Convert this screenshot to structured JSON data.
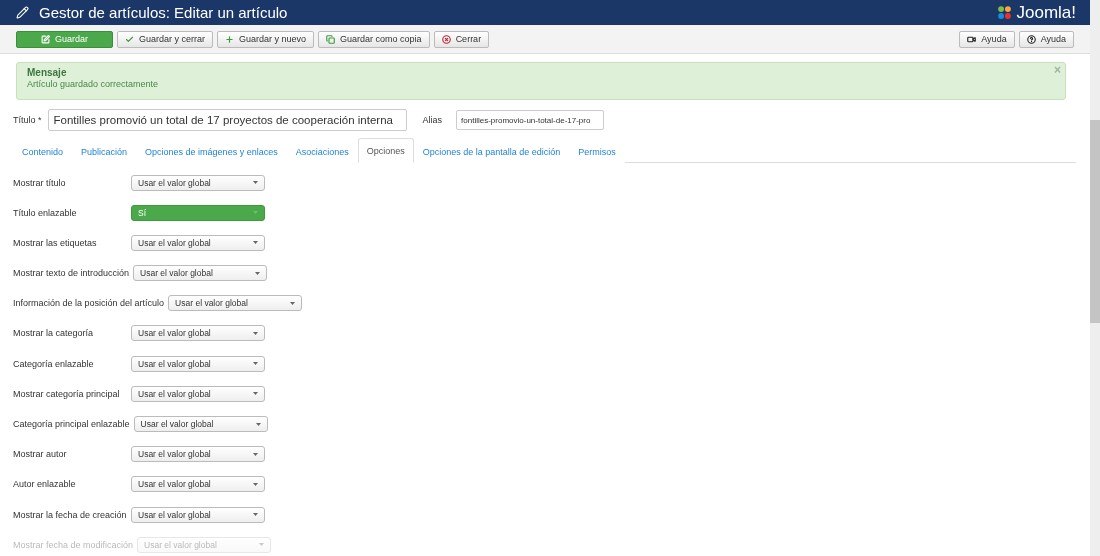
{
  "header": {
    "title": "Gestor de artículos: Editar un artículo",
    "logo": "Joomla!"
  },
  "toolbar": {
    "left": [
      {
        "label": "Guardar",
        "kind": "primary"
      },
      {
        "label": "Guardar y cerrar",
        "kind": "default"
      },
      {
        "label": "Guardar y nuevo",
        "kind": "default"
      },
      {
        "label": "Guardar como copia",
        "kind": "default"
      },
      {
        "label": "Cerrar",
        "kind": "default"
      }
    ],
    "right": [
      {
        "label": "Ayuda"
      },
      {
        "label": "Ayuda"
      }
    ]
  },
  "message": {
    "heading": "Mensaje",
    "text": "Artículo guardado correctamente",
    "close": "×"
  },
  "title_field": {
    "label": "Título *",
    "value": "Fontilles promovió un total de 17 proyectos de cooperación interna"
  },
  "alias_field": {
    "label": "Alias",
    "value": "fontilles-promovio-un-total-de-17-pro"
  },
  "tabs": [
    {
      "label": "Contenido",
      "selected": false
    },
    {
      "label": "Publicación",
      "selected": false
    },
    {
      "label": "Opciones de imágenes y enlaces",
      "selected": false
    },
    {
      "label": "Asociaciones",
      "selected": false
    },
    {
      "label": "Opciones",
      "selected": true
    },
    {
      "label": "Opciones de la pantalla de edición",
      "selected": false
    },
    {
      "label": "Permisos",
      "selected": false
    }
  ],
  "options": [
    {
      "label": "Mostrar título",
      "value": "Usar el valor global",
      "kind": "plain"
    },
    {
      "label": "Título enlazable",
      "value": "Sí",
      "kind": "yes"
    },
    {
      "label": "Mostrar las etiquetas",
      "value": "Usar el valor global",
      "kind": "plain"
    },
    {
      "label": "Mostrar texto de introducción",
      "value": "Usar el valor global",
      "kind": "plain"
    },
    {
      "label": "Información de la posición del artículo",
      "value": "Usar el valor global",
      "kind": "plain"
    },
    {
      "label": "Mostrar la categoría",
      "value": "Usar el valor global",
      "kind": "plain"
    },
    {
      "label": "Categoría enlazable",
      "value": "Usar el valor global",
      "kind": "plain"
    },
    {
      "label": "Mostrar categoría principal",
      "value": "Usar el valor global",
      "kind": "plain"
    },
    {
      "label": "Categoría principal enlazable",
      "value": "Usar el valor global",
      "kind": "plain"
    },
    {
      "label": "Mostrar autor",
      "value": "Usar el valor global",
      "kind": "plain"
    },
    {
      "label": "Autor enlazable",
      "value": "Usar el valor global",
      "kind": "plain"
    },
    {
      "label": "Mostrar la fecha de creación",
      "value": "Usar el valor global",
      "kind": "plain"
    },
    {
      "label": "Mostrar fecha de modificación",
      "value": "Usar el valor global",
      "kind": "plain"
    }
  ]
}
